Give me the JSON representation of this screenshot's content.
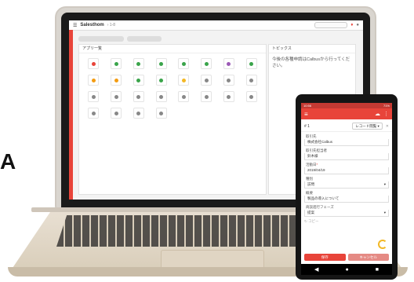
{
  "stage_letter": "A",
  "laptop": {
    "brand": "Salesthom",
    "crumb": "› 1-8",
    "search_placeholder": "",
    "filters": [
      "",
      ""
    ],
    "apps_title": "アプリ一覧",
    "apps": [
      {
        "label": "",
        "color": "#e8443a"
      },
      {
        "label": "",
        "color": "#3aa44a"
      },
      {
        "label": "",
        "color": "#3aa44a"
      },
      {
        "label": "",
        "color": "#3aa44a"
      },
      {
        "label": "",
        "color": "#3aa44a"
      },
      {
        "label": "",
        "color": "#3aa44a"
      },
      {
        "label": "",
        "color": "#9b59b6"
      },
      {
        "label": "",
        "color": "#3aa44a"
      },
      {
        "label": "",
        "color": "#f39c12"
      },
      {
        "label": "",
        "color": "#f39c12"
      },
      {
        "label": "",
        "color": "#3aa44a"
      },
      {
        "label": "",
        "color": "#3aa44a"
      },
      {
        "label": "",
        "color": "#f3b825"
      },
      {
        "label": "",
        "color": "#888"
      },
      {
        "label": "",
        "color": "#888"
      },
      {
        "label": "",
        "color": "#888"
      },
      {
        "label": "",
        "color": "#888"
      },
      {
        "label": "",
        "color": "#888"
      },
      {
        "label": "",
        "color": "#888"
      },
      {
        "label": "",
        "color": "#888"
      },
      {
        "label": "",
        "color": "#888"
      },
      {
        "label": "",
        "color": "#888"
      },
      {
        "label": "",
        "color": "#888"
      },
      {
        "label": "",
        "color": "#888"
      },
      {
        "label": "",
        "color": "#888"
      },
      {
        "label": "",
        "color": "#888"
      },
      {
        "label": "",
        "color": "#888"
      },
      {
        "label": "",
        "color": "#888"
      }
    ],
    "topics_title": "トピックス",
    "topics_text": "今後の各種申請はCalbusから行ってください。"
  },
  "phone": {
    "status_left": "10:56",
    "status_right": "71%",
    "record_no": "# 1",
    "record_select": "レコード閲覧",
    "fields": [
      {
        "label": "取引先",
        "value": "株式会社Calbus",
        "select": false,
        "required": false
      },
      {
        "label": "取引先担当者",
        "value": "鈴木様",
        "select": false,
        "required": false
      },
      {
        "label": "活動日",
        "value": "2019/04/19",
        "select": false,
        "required": true
      },
      {
        "label": "種別",
        "value": "訪問",
        "select": true,
        "required": false
      },
      {
        "label": "概要",
        "value": "製品の導入について",
        "select": false,
        "required": false
      },
      {
        "label": "商談進行フェーズ",
        "value": "提案",
        "select": true,
        "required": false
      }
    ],
    "copy_label": "コピー",
    "buttons": [
      {
        "label": "保存",
        "color": "#e8443a"
      },
      {
        "label": "キャンセル",
        "color": "#e58a84"
      }
    ],
    "nav": [
      "◀",
      "●",
      "■"
    ]
  }
}
